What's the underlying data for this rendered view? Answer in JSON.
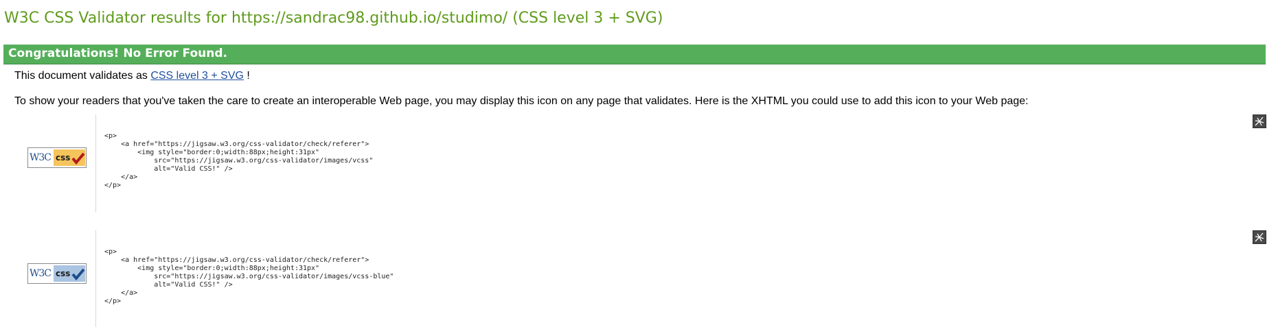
{
  "page_title": "W3C CSS Validator results for https://sandrac98.github.io/studimo/ (CSS level 3 + SVG)",
  "banner": {
    "text": "Congratulations! No Error Found."
  },
  "validates": {
    "prefix": "This document validates as ",
    "link_text": "CSS level 3 + SVG",
    "suffix": " !"
  },
  "info_text": "To show your readers that you've taken the care to create an interoperable Web page, you may display this icon on any page that validates. Here is the XHTML you could use to add this icon to your Web page:",
  "badges": [
    {
      "w3c_text": "W3C",
      "css_text": "css",
      "check_color": "#b01a1a",
      "code": "<p>\n    <a href=\"https://jigsaw.w3.org/css-validator/check/referer\">\n        <img style=\"border:0;width:88px;height:31px\"\n            src=\"https://jigsaw.w3.org/css-validator/images/vcss\"\n            alt=\"Valid CSS!\" />\n    </a>\n</p>",
      "icon": "copy-icon"
    },
    {
      "w3c_text": "W3C",
      "css_text": "css",
      "check_color": "#1d4d8a",
      "code": "<p>\n    <a href=\"https://jigsaw.w3.org/css-validator/check/referer\">\n        <img style=\"border:0;width:88px;height:31px\"\n            src=\"https://jigsaw.w3.org/css-validator/images/vcss-blue\"\n            alt=\"Valid CSS!\" />\n    </a>\n</p>",
      "icon": "copy-icon"
    }
  ],
  "colors": {
    "title": "#5f9b1c",
    "banner": "#55af5a",
    "link": "#1f4e9e"
  }
}
